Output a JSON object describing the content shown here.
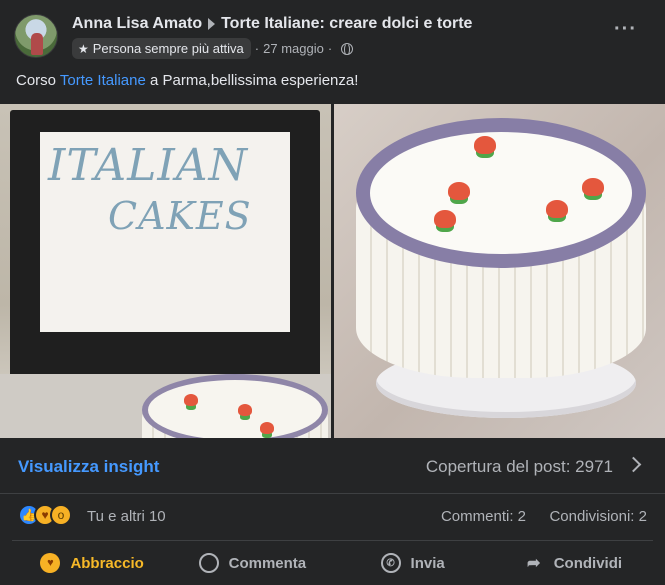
{
  "header": {
    "author": "Anna Lisa Amato",
    "group": "Torte Italiane: creare dolci e torte",
    "badge": "Persona sempre più attiva",
    "date": "27 maggio",
    "separator": "·"
  },
  "post": {
    "text_before": "Corso ",
    "text_link": "Torte Italiane",
    "text_after": " a Parma,bellissima esperienza!",
    "photo_sign_line1": "ITALIAN",
    "photo_sign_line2": "CAKES"
  },
  "insight": {
    "link": "Visualizza insight",
    "reach": "Copertura del post: 2971"
  },
  "reactions": {
    "summary": "Tu e altri 10",
    "comments": "Commenti: 2",
    "shares": "Condivisioni: 2",
    "icons": [
      "like-icon",
      "hug-icon",
      "wow-icon"
    ]
  },
  "actions": {
    "hug": "Abbraccio",
    "comment": "Commenta",
    "send": "Invia",
    "share": "Condividi"
  },
  "colors": {
    "background": "#242526",
    "link": "#4599ff",
    "hug": "#f7b928",
    "muted": "#b0b3b8"
  }
}
